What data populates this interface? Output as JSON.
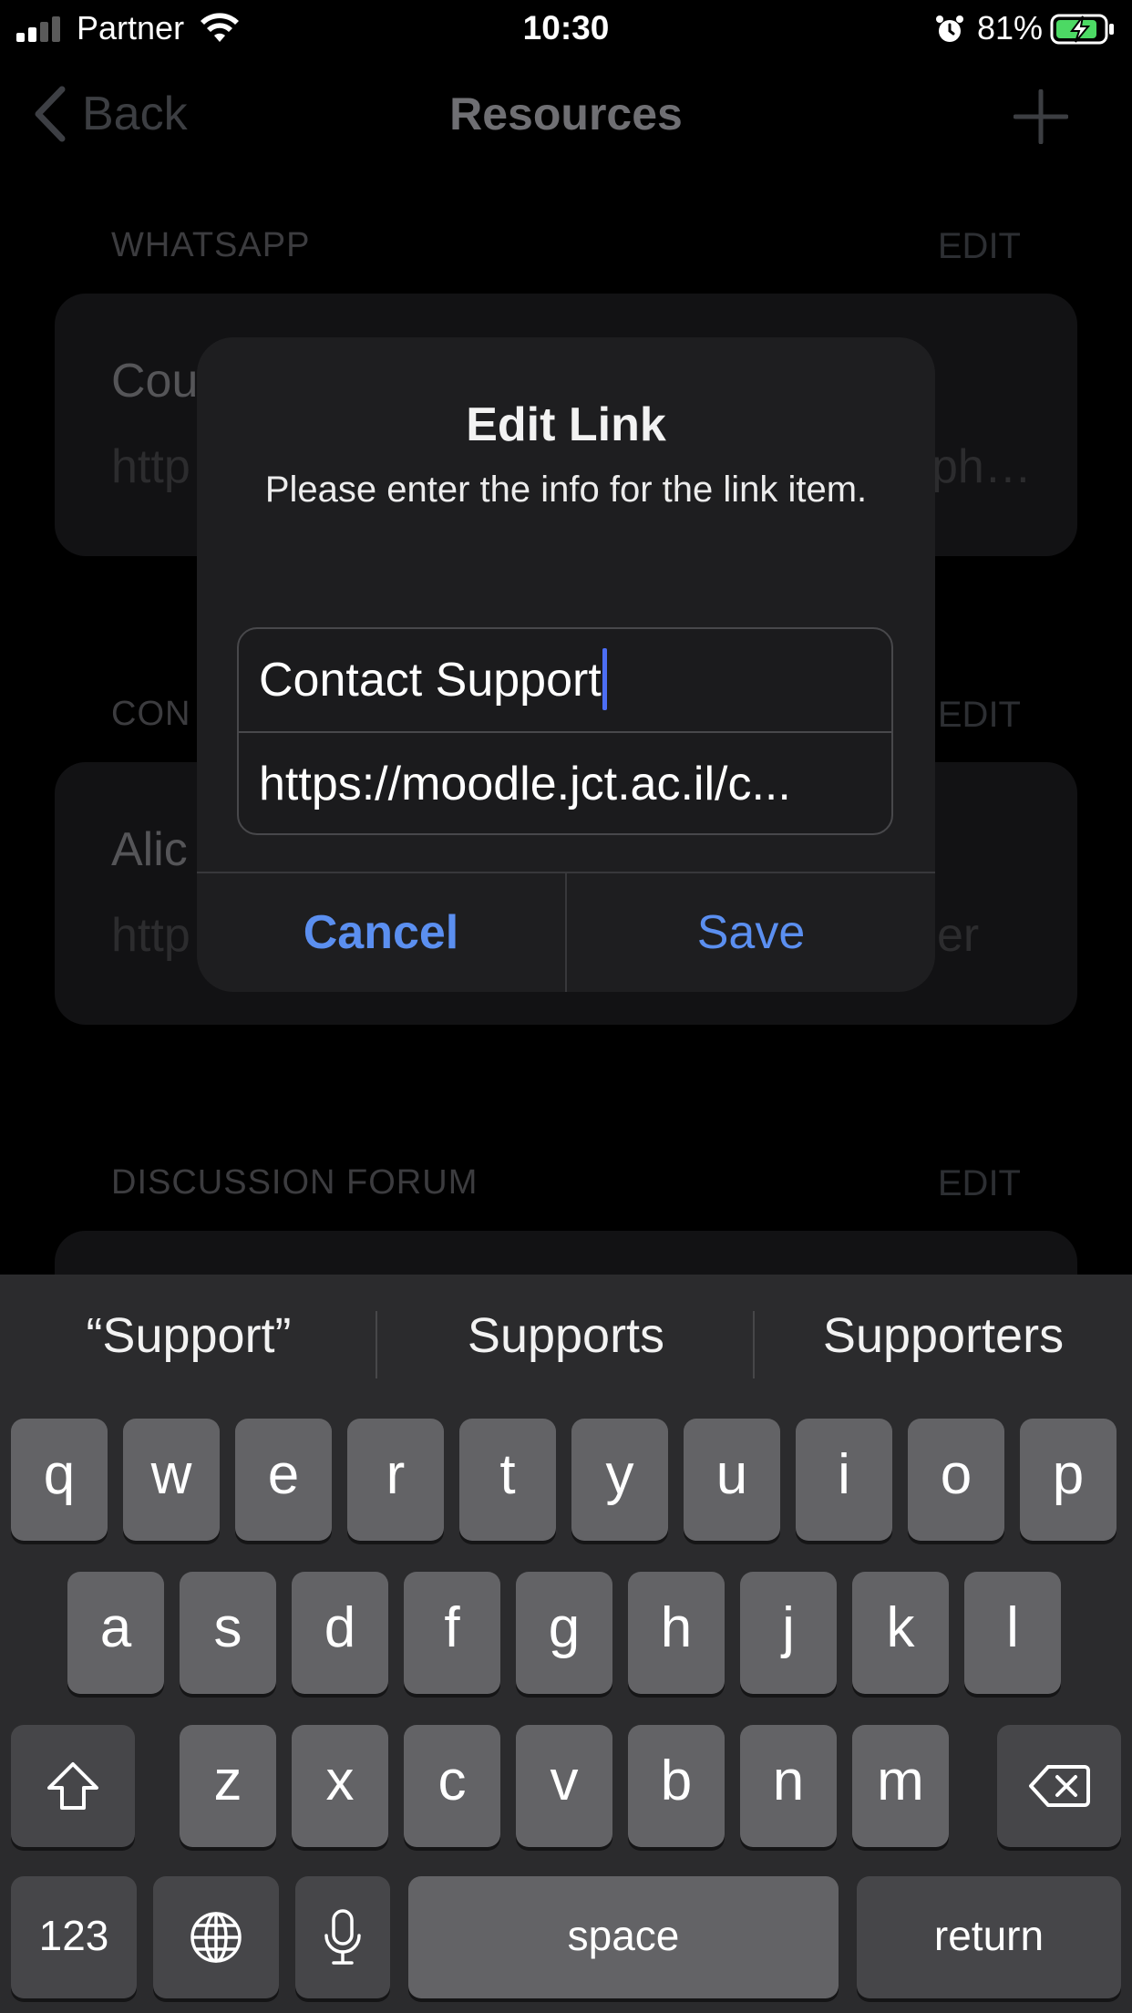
{
  "status_bar": {
    "carrier": "Partner",
    "time": "10:30",
    "battery_percent": "81%",
    "icons": [
      "signal-icon",
      "wifi-icon",
      "alarm-icon",
      "battery-charging-icon"
    ]
  },
  "nav": {
    "back_label": "Back",
    "title": "Resources",
    "add_icon": "plus-icon"
  },
  "sections": [
    {
      "header": "WHATSAPP",
      "edit": "EDIT",
      "item_title": "Cou",
      "item_url": "http",
      "item_url_tail": "ph…"
    },
    {
      "header": "CON",
      "edit": "EDIT",
      "item_title": "Alic",
      "item_url": "http",
      "item_url_tail": "er"
    },
    {
      "header": "DISCUSSION FORUM",
      "edit": "EDIT"
    }
  ],
  "dialog": {
    "title": "Edit Link",
    "message": "Please enter the info for the link item.",
    "name_value": "Contact Support",
    "url_value": "https://moodle.jct.ac.il/c...",
    "cancel_label": "Cancel",
    "save_label": "Save"
  },
  "keyboard": {
    "suggestions": [
      "“Support”",
      "Supports",
      "Supporters"
    ],
    "row1": [
      "q",
      "w",
      "e",
      "r",
      "t",
      "y",
      "u",
      "i",
      "o",
      "p"
    ],
    "row2": [
      "a",
      "s",
      "d",
      "f",
      "g",
      "h",
      "j",
      "k",
      "l"
    ],
    "row3": [
      "z",
      "x",
      "c",
      "v",
      "b",
      "n",
      "m"
    ],
    "numbers_label": "123",
    "space_label": "space",
    "return_label": "return",
    "icons": [
      "shift-icon",
      "delete-icon",
      "globe-icon",
      "microphone-icon"
    ]
  },
  "colors": {
    "accent_blue": "#5b8ff0",
    "caret_blue": "#4c6ef5",
    "key_light": "#636366",
    "key_dark": "#464649",
    "keyboard_bg": "#2b2b2d",
    "dialog_bg": "#1e1e20"
  }
}
